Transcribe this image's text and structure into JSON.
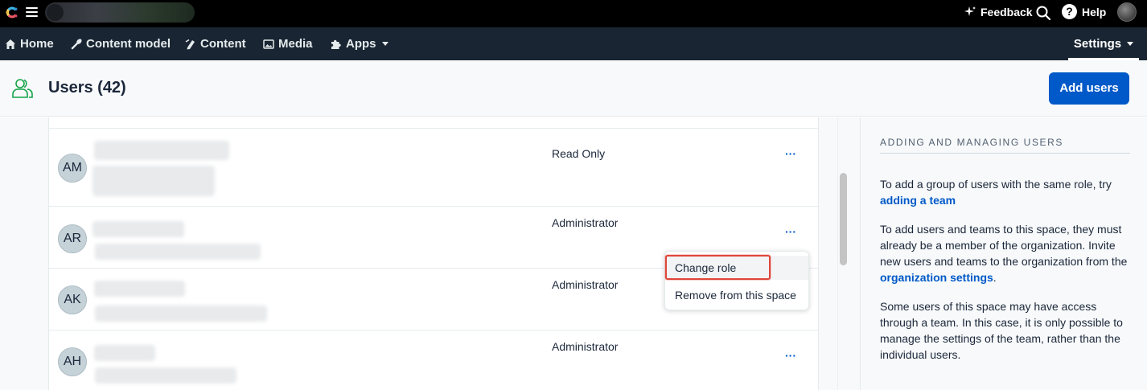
{
  "topbar": {
    "feedback_label": "Feedback",
    "help_label": "Help",
    "help_glyph": "?"
  },
  "nav": {
    "items": [
      {
        "label": "Home",
        "icon": "home-icon"
      },
      {
        "label": "Content model",
        "icon": "wrench-icon"
      },
      {
        "label": "Content",
        "icon": "content-icon"
      },
      {
        "label": "Media",
        "icon": "image-icon"
      },
      {
        "label": "Apps",
        "icon": "puzzle-icon"
      }
    ],
    "settings_label": "Settings"
  },
  "header": {
    "title": "Users (42)",
    "add_users_label": "Add users"
  },
  "users": [
    {
      "initials": "AM",
      "role": "Read Only"
    },
    {
      "initials": "AR",
      "role": "Administrator"
    },
    {
      "initials": "AK",
      "role": "Administrator"
    },
    {
      "initials": "AH",
      "role": "Administrator"
    }
  ],
  "row_actions_label": "···",
  "dropdown": {
    "items": [
      "Change role",
      "Remove from this space"
    ]
  },
  "sidebar": {
    "heading": "ADDING AND MANAGING USERS",
    "p1_text": "To add a group of users with the same role, try ",
    "p1_link": "adding a team",
    "p2_text": "To add users and teams to this space, they must already be a member of the organization. Invite new users and teams to the organization from the ",
    "p2_link": "organization settings",
    "p2_end": ".",
    "p3_text": "Some users of this space may have access through a team. In this case, it is only possible to manage the settings of the team, rather than the individual users."
  },
  "colors": {
    "topbar": "#000000",
    "navbar": "#192532",
    "accent": "#0059c8",
    "highlight": "#e0463a"
  }
}
